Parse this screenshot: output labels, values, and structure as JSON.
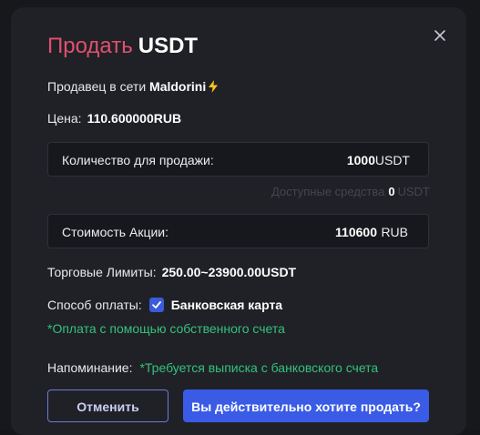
{
  "modal": {
    "title_action": "Продать",
    "title_asset": "USDT",
    "seller_prefix": "Продавец в сети",
    "seller_name": "Maldorini",
    "price_label": "Цена:",
    "price_value": "110.600000RUB",
    "quantity": {
      "label": "Количество для продажи:",
      "value": "1000",
      "unit": "USDT"
    },
    "available": {
      "label": "Доступные средства",
      "value": "0",
      "unit": "USDT"
    },
    "cost": {
      "label": "Стоимость Акции:",
      "value": "110600",
      "unit": "RUB"
    },
    "limits_label": "Торговые Лимиты:",
    "limits_value": "250.00~23900.00USDT",
    "payment_label": "Способ оплаты:",
    "payment_method": "Банковская карта",
    "payment_checked": true,
    "payment_note": "*Оплата с помощью собственного счета",
    "reminder_label": "Напоминание:",
    "reminder_text": "*Требуется выписка с банковского счета",
    "cancel_label": "Отменить",
    "confirm_label": "Вы действительно хотите продать?"
  },
  "icons": {
    "close": "close-icon",
    "bolt": "lightning-bolt-icon",
    "check": "checkmark-icon"
  },
  "colors": {
    "accent_red": "#e0506e",
    "accent_blue": "#3a5be6",
    "success_green": "#33c27a",
    "bolt_yellow": "#f5c518"
  }
}
